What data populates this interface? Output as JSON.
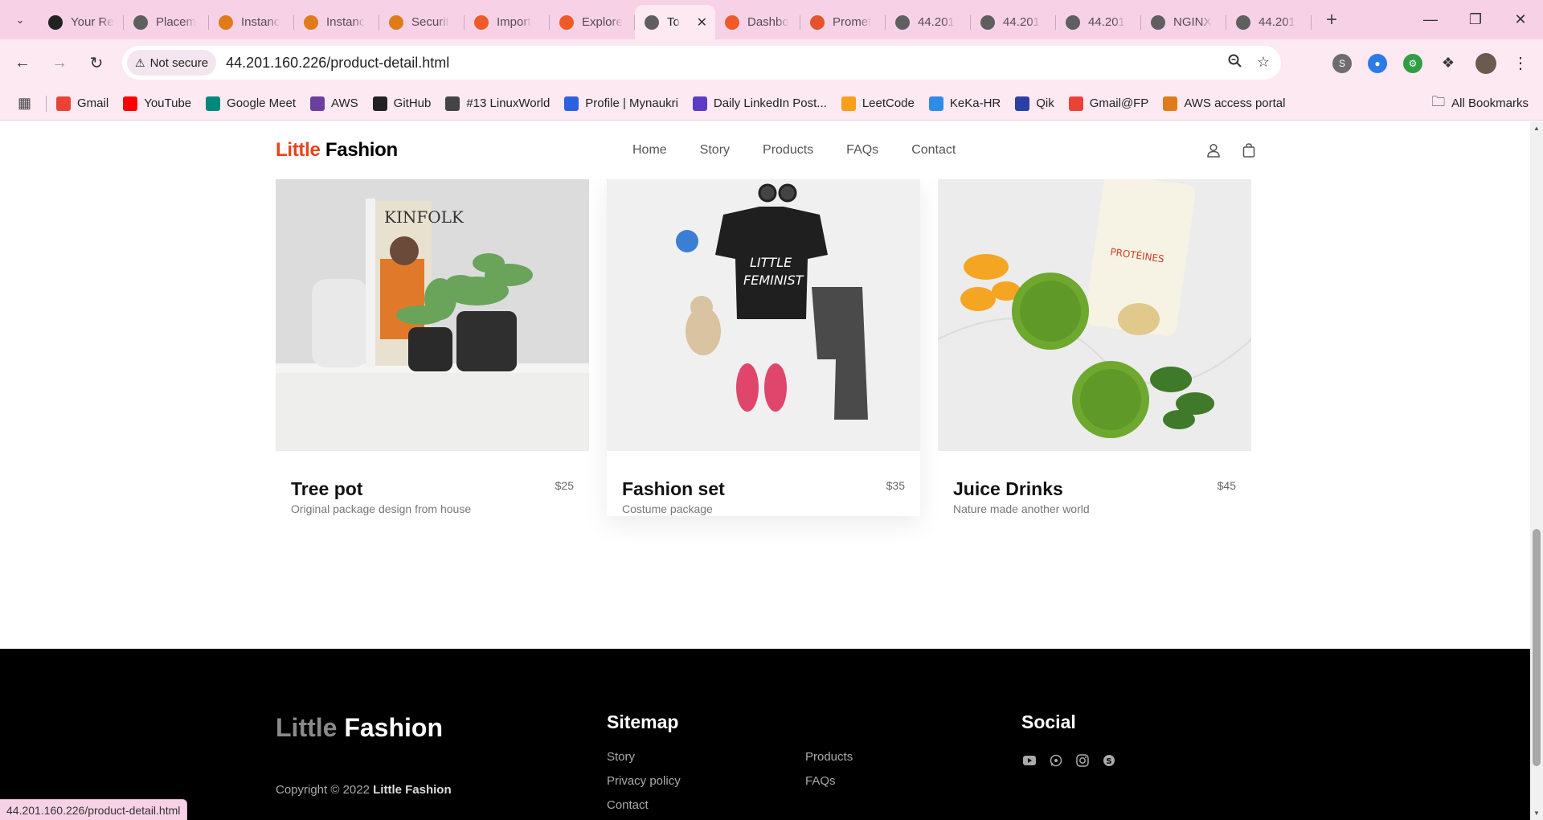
{
  "browser": {
    "tabs": [
      {
        "label": "Your Re",
        "icon": "github-icon",
        "color": "#222222"
      },
      {
        "label": "Placem",
        "icon": "globe-icon",
        "color": "#5f5f5f"
      },
      {
        "label": "Instanc",
        "icon": "aws-icon",
        "color": "#e07b1a"
      },
      {
        "label": "Instanc",
        "icon": "aws-icon",
        "color": "#e07b1a"
      },
      {
        "label": "Securit",
        "icon": "aws-icon",
        "color": "#e07b1a"
      },
      {
        "label": "Import",
        "icon": "grafana-icon",
        "color": "#f05a28"
      },
      {
        "label": "Explore",
        "icon": "grafana-icon",
        "color": "#f05a28"
      },
      {
        "label": "To",
        "icon": "globe-icon",
        "color": "#5f5f5f",
        "active": true
      },
      {
        "label": "Dashbo",
        "icon": "grafana-icon",
        "color": "#f05a28"
      },
      {
        "label": "Promet",
        "icon": "prometheus-icon",
        "color": "#e6522c"
      },
      {
        "label": "44.201",
        "icon": "globe-icon",
        "color": "#5f5f5f"
      },
      {
        "label": "44.201",
        "icon": "globe-icon",
        "color": "#5f5f5f"
      },
      {
        "label": "44.201",
        "icon": "globe-icon",
        "color": "#5f5f5f"
      },
      {
        "label": "NGINX",
        "icon": "globe-icon",
        "color": "#5f5f5f"
      },
      {
        "label": "44.201",
        "icon": "globe-icon",
        "color": "#5f5f5f"
      }
    ],
    "security_label": "Not secure",
    "url": "44.201.160.226/product-detail.html",
    "bookmarks": [
      {
        "label": "Gmail",
        "icon": "gmail-icon",
        "color": "#ea4335"
      },
      {
        "label": "YouTube",
        "icon": "youtube-icon",
        "color": "#ff0000"
      },
      {
        "label": "Google Meet",
        "icon": "meet-icon",
        "color": "#00897b"
      },
      {
        "label": "AWS",
        "icon": "aws-icon",
        "color": "#6b3fa0"
      },
      {
        "label": "GitHub",
        "icon": "github-icon",
        "color": "#222222"
      },
      {
        "label": "#13 LinuxWorld",
        "icon": "linuxworld-icon",
        "color": "#444444"
      },
      {
        "label": "Profile | Mynaukri",
        "icon": "naukri-icon",
        "color": "#2a62e0"
      },
      {
        "label": "Daily LinkedIn Post...",
        "icon": "doc-icon",
        "color": "#5b3cc4"
      },
      {
        "label": "LeetCode",
        "icon": "leetcode-icon",
        "color": "#f89f1b"
      },
      {
        "label": "KeKa-HR",
        "icon": "keka-icon",
        "color": "#2e8be6"
      },
      {
        "label": "Qik",
        "icon": "qik-icon",
        "color": "#2b3fa8"
      },
      {
        "label": "Gmail@FP",
        "icon": "gmail-icon",
        "color": "#ea4335"
      },
      {
        "label": "AWS access portal",
        "icon": "aws-icon",
        "color": "#e07b1a"
      }
    ],
    "all_bookmarks": "All Bookmarks",
    "status_url": "44.201.160.226/product-detail.html"
  },
  "site": {
    "brand_accent": "Little",
    "brand_main": "Fashion",
    "menu": [
      "Home",
      "Story",
      "Products",
      "FAQs",
      "Contact"
    ],
    "products": [
      {
        "title": "Tree pot",
        "price": "$25",
        "desc": "Original package design from house"
      },
      {
        "title": "Fashion set",
        "price": "$35",
        "desc": "Costume package"
      },
      {
        "title": "Juice Drinks",
        "price": "$45",
        "desc": "Nature made another world"
      }
    ],
    "footer": {
      "brand_accent": "Little",
      "brand_main": "Fashion",
      "copyright_prefix": "Copyright © 2022",
      "copyright_brand": "Little Fashion",
      "sitemap_title": "Sitemap",
      "sitemap_col1": [
        "Story",
        "Privacy policy",
        "Contact"
      ],
      "sitemap_col2": [
        "Products",
        "FAQs"
      ],
      "social_title": "Social",
      "social_icons": [
        "youtube-icon",
        "whatsapp-icon",
        "instagram-icon",
        "skype-icon"
      ]
    },
    "accent_color": "#e8431b"
  }
}
